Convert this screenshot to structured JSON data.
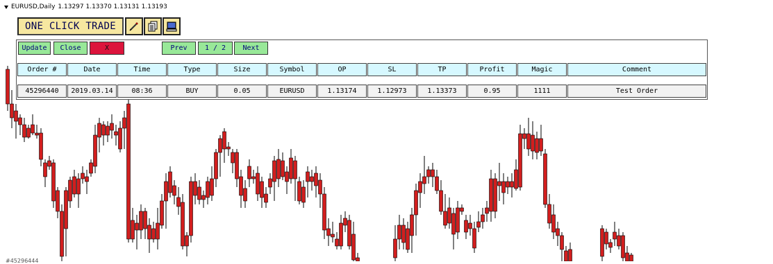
{
  "symbol_header": {
    "symbol_timeframe": "EURUSD,Daily",
    "ohlc": "1.13297 1.13370 1.13131 1.13193"
  },
  "toolbar": {
    "title": "ONE CLICK TRADE",
    "icons": [
      "pencil-icon",
      "document-list-icon",
      "monitor-icon"
    ]
  },
  "buttons": {
    "update": "Update",
    "close": "Close",
    "x": "X",
    "prev": "Prev",
    "page": "1 / 2",
    "next": "Next"
  },
  "table": {
    "columns": [
      "Order #",
      "Date",
      "Time",
      "Type",
      "Size",
      "Symbol",
      "OP",
      "SL",
      "TP",
      "Profit",
      "Magic",
      "Comment"
    ],
    "rows": [
      [
        "45296440",
        "2019.03.14",
        "08:36",
        "BUY",
        "0.05",
        "EURUSD",
        "1.13174",
        "1.12973",
        "1.13373",
        "0.95",
        "1111",
        "Test Order"
      ]
    ]
  },
  "bottom_tag": "#45296444",
  "colors": {
    "bull_candle": "#1e8c1e",
    "bear_candle": "#d21e1e",
    "header_cell": "#d6f8ff",
    "button_green": "#98e898",
    "button_red": "#dc143c",
    "title_bg": "#f6e7a0"
  }
}
